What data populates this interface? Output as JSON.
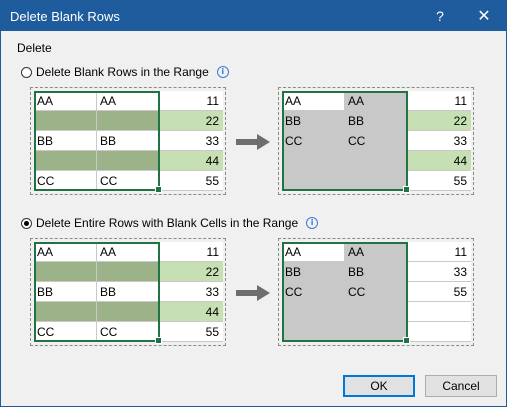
{
  "window": {
    "title": "Delete Blank Rows",
    "help_label": "?",
    "close_label": "✕"
  },
  "group_label": "Delete",
  "options": [
    {
      "label": "Delete Blank Rows in the Range",
      "selected": false,
      "info_icon": "info-icon"
    },
    {
      "label": "Delete Entire Rows with Blank Cells in the Range",
      "selected": true,
      "info_icon": "info-icon"
    }
  ],
  "previews": {
    "option1_before": [
      [
        "AA",
        "AA",
        "11"
      ],
      [
        "",
        "",
        "22"
      ],
      [
        "BB",
        "BB",
        "33"
      ],
      [
        "",
        "",
        "44"
      ],
      [
        "CC",
        "CC",
        "55"
      ]
    ],
    "option1_after": [
      [
        "AA",
        "AA",
        "11"
      ],
      [
        "BB",
        "BB",
        "22"
      ],
      [
        "CC",
        "CC",
        "33"
      ],
      [
        "",
        "",
        "44"
      ],
      [
        "",
        "",
        "55"
      ]
    ],
    "option2_before": [
      [
        "AA",
        "AA",
        "11"
      ],
      [
        "",
        "",
        "22"
      ],
      [
        "BB",
        "BB",
        "33"
      ],
      [
        "",
        "",
        "44"
      ],
      [
        "CC",
        "CC",
        "55"
      ]
    ],
    "option2_after": [
      [
        "AA",
        "AA",
        "11"
      ],
      [
        "BB",
        "BB",
        "33"
      ],
      [
        "CC",
        "CC",
        "55"
      ],
      [
        "",
        "",
        ""
      ],
      [
        "",
        "",
        ""
      ]
    ]
  },
  "colors": {
    "titlebar": "#1e5c9e",
    "selection_border": "#217346",
    "blank_row_selected": "#9cb389",
    "blank_row_outside": "#c6e0b4",
    "selected_cell": "#c8c8c8"
  },
  "buttons": {
    "ok": "OK",
    "cancel": "Cancel"
  }
}
